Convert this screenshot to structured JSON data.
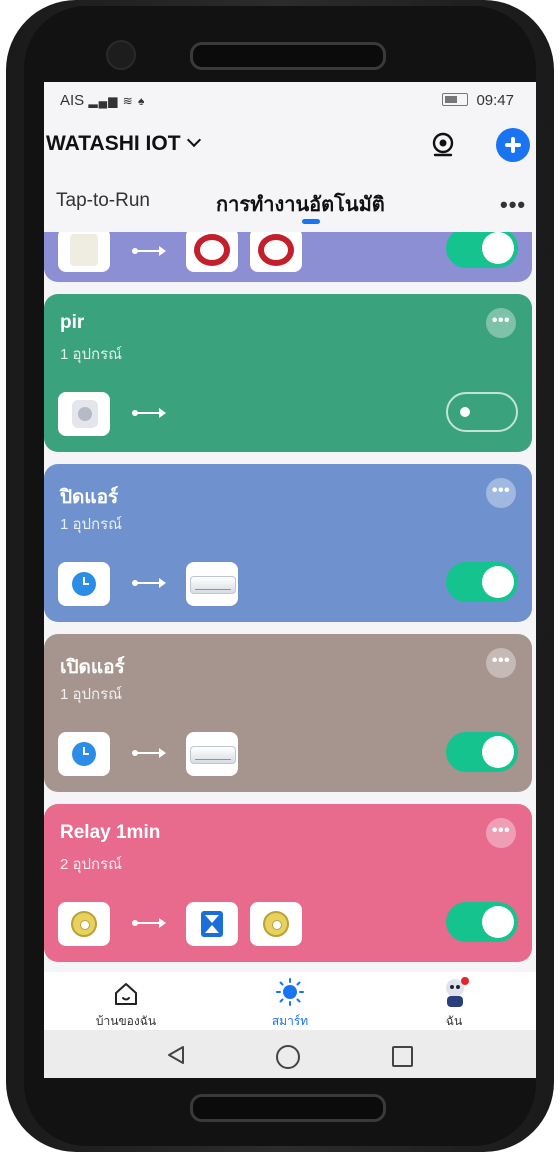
{
  "status_bar": {
    "carrier": "AIS",
    "signal_icons": "signal wifi notification",
    "time": "09:47"
  },
  "header": {
    "home_name": "WATASHI IOT",
    "camera_icon": "eye-icon",
    "add_icon": "plus-icon"
  },
  "tabs": [
    {
      "label": "Tap-to-Run",
      "active": false
    },
    {
      "label": "การทำงานอัตโนมัติ",
      "active": true
    }
  ],
  "tabs_more": "•••",
  "cards": [
    {
      "title": "pir",
      "subtitle": "1 อุปกรณ์",
      "enabled": false,
      "color": "#3aa27d"
    },
    {
      "title": "ปิดแอร์",
      "subtitle": "1 อุปกรณ์",
      "enabled": true,
      "color": "#6f92cf"
    },
    {
      "title": "เปิดแอร์",
      "subtitle": "1 อุปกรณ์",
      "enabled": true,
      "color": "#a6958e"
    },
    {
      "title": "Relay 1min",
      "subtitle": "2 อุปกรณ์",
      "enabled": true,
      "color": "#e86b8e"
    }
  ],
  "card_more": "•••",
  "partial_card": {
    "color": "#8d8fd4",
    "enabled": true
  },
  "bottom_nav": [
    {
      "label": "บ้านของฉัน",
      "icon": "home-icon",
      "active": false
    },
    {
      "label": "สมาร์ท",
      "icon": "sun-icon",
      "active": true
    },
    {
      "label": "ฉัน",
      "icon": "profile-icon",
      "active": false
    }
  ],
  "colors": {
    "accent": "#1a73f0",
    "toggle_on": "#14c38e"
  }
}
